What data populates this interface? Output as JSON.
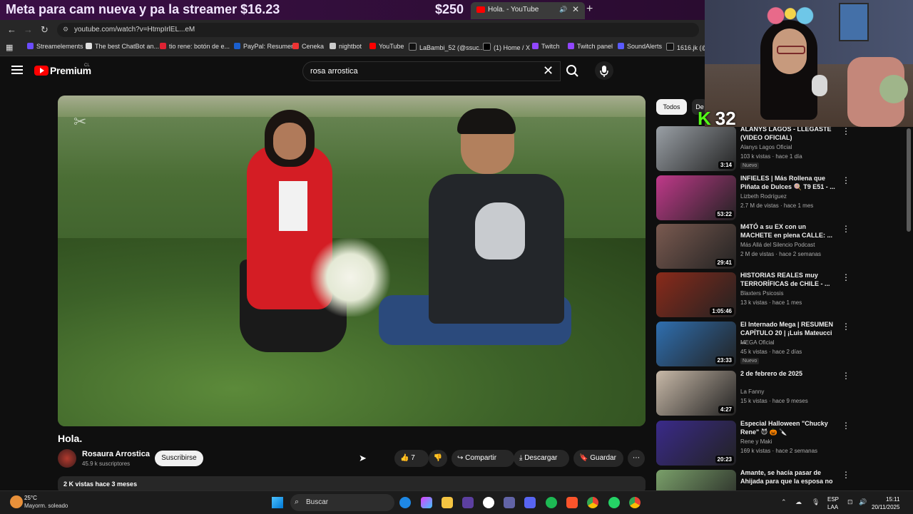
{
  "banner": {
    "text": "Meta para cam nueva y pa la streamer $16.23",
    "amount": "$250"
  },
  "browser": {
    "tab_title": "Hola. - YouTube",
    "url": "youtube.com/watch?v=HtmpIrlEL...eM",
    "bookmarks": [
      "Streamelements",
      "The best ChatBot an...",
      "tio rene: botón de e...",
      "PayPal: Resumen",
      "Ceneka",
      "nightbot",
      "YouTube",
      "LaBambi_52 (@ssuc...",
      "(1) Home / X",
      "Twitch",
      "Twitch panel",
      "SoundAlerts",
      "1616.jk (@1"
    ]
  },
  "youtube": {
    "logo_label": "Premium",
    "region": "CL",
    "search_query": "rosa arrostica"
  },
  "video": {
    "title": "Hola.",
    "channel": "Rosaura Arrostica",
    "subscribers": "45.9 k suscriptores",
    "subscribe_label": "Suscribirse",
    "likes": "7",
    "share_label": "Compartir",
    "download_label": "Descargar",
    "save_label": "Guardar",
    "views_date": "2 K vistas  hace 3 meses"
  },
  "sidebar": {
    "chips": [
      "Todos",
      "De"
    ],
    "items": [
      {
        "title": "ALANYS LAGOS - LLEGASTE (VIDEO OFICIAL)",
        "channel": "Alanys Lagos Oficial",
        "meta": "103 k vistas · hace 1 día",
        "duration": "3:14",
        "badge": "Nuevo",
        "thumb_color": "#9aa0a6"
      },
      {
        "title": "INFIELES | Más Rollena que Piñata de Dulces 🍭 T9 E51 - ...",
        "channel": "Lizbeth Rodríguez",
        "meta": "2.7 M de vistas · hace 1 mes",
        "duration": "53:22",
        "badge": "",
        "thumb_color": "#c0398a"
      },
      {
        "title": "M4TÓ a su EX con un MACHETE en plena CALLE: ...",
        "channel": "Más Allá del Silencio Podcast",
        "meta": "2 M de vistas · hace 2 semanas",
        "duration": "29:41",
        "badge": "",
        "thumb_color": "#7a5a50"
      },
      {
        "title": "HISTORIAS REALES muy TERRORÍFICAS de CHILE - ...",
        "channel": "Blaxters Psicosis",
        "meta": "13 k vistas · hace 1 mes",
        "duration": "1:05:46",
        "badge": "",
        "thumb_color": "#8a2a1a"
      },
      {
        "title": "El Internado Mega | RESUMEN CAPÍTULO 20 | ¡Luis Mateucci ...",
        "channel": "MEGA Oficial",
        "meta": "45 k vistas · hace 2 días",
        "duration": "23:33",
        "badge": "Nuevo",
        "thumb_color": "#2f6fb0"
      },
      {
        "title": "2 de febrero de 2025",
        "channel": "La Fanny",
        "meta": "15 k vistas · hace 9 meses",
        "duration": "4:27",
        "badge": "",
        "thumb_color": "#c8b9a8"
      },
      {
        "title": "Especial Halloween \"Chucky Rene\" 😈 🎃 🔪",
        "channel": "Rene y Maki",
        "meta": "169 k vistas · hace 2 semanas",
        "duration": "20:23",
        "badge": "",
        "thumb_color": "#3a2a8a"
      },
      {
        "title": "Amante, se hacía pasar de Ahijada para que la esposa no ...",
        "channel": "",
        "meta": "",
        "duration": "",
        "badge": "",
        "thumb_color": "#7aa06a"
      }
    ]
  },
  "overlay": {
    "kick_count": "32",
    "kick_letter": "K"
  },
  "taskbar": {
    "temp": "25°C",
    "weather": "Mayorm. soleado",
    "search_label": "Buscar",
    "lang1": "ESP",
    "lang2": "LAA",
    "time": "15:11",
    "date": "20/11/2025"
  }
}
